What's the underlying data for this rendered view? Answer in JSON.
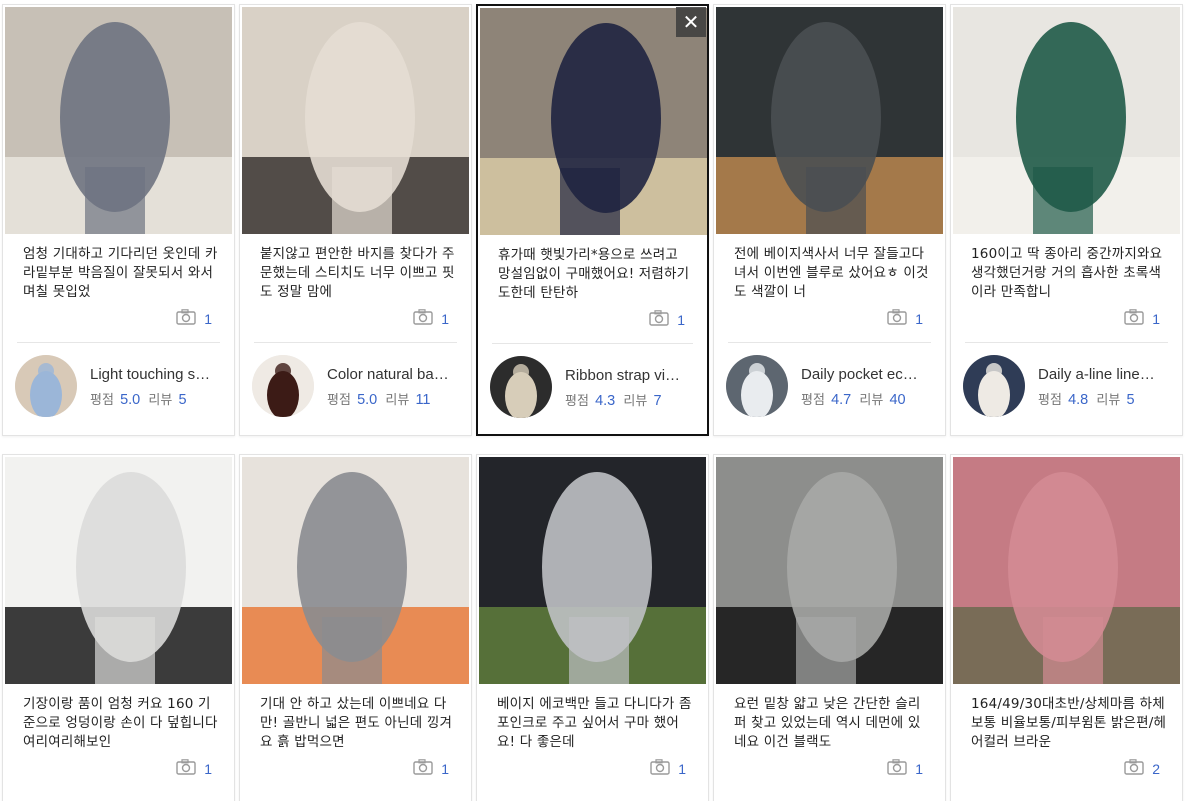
{
  "cards": [
    {
      "review": "엄청 기대하고 기다리던 옷인데 카라밑부분 박음질이 잘못되서 와서 며칠 못입었",
      "photo_count": "1",
      "product_name": "Light touching s…",
      "rating_label": "평점",
      "rating": "5.0",
      "review_label": "리뷰",
      "review_count": "5",
      "photo_colors": [
        "#c7c0b6",
        "#6e7381",
        "#e9e5de"
      ],
      "avatar_colors": [
        "#9bb6d8",
        "#d8c9b7"
      ]
    },
    {
      "review": "붙지않고 편안한 바지를 찾다가 주문했는데 스티치도 너무 이쁘고 핏도 정말 맘에",
      "photo_count": "1",
      "product_name": "Color natural ba…",
      "rating_label": "평점",
      "rating": "5.0",
      "review_label": "리뷰",
      "review_count": "11",
      "photo_colors": [
        "#d9d1c6",
        "#e4ddd3",
        "#3a3531"
      ],
      "avatar_colors": [
        "#3c1b16",
        "#efeae4"
      ]
    },
    {
      "review": "휴가때 햇빛가리*용으로 쓰려고 망설임없이 구매했어요! 저렴하기도한데 탄탄하",
      "photo_count": "1",
      "product_name": "Ribbon strap vi…",
      "rating_label": "평점",
      "rating": "4.3",
      "review_label": "리뷰",
      "review_count": "7",
      "photo_colors": [
        "#8e8478",
        "#1f2340",
        "#d8c9a5"
      ],
      "avatar_colors": [
        "#d7cdb9",
        "#2c2c2c"
      ],
      "selected": true,
      "close_glyph": "✕"
    },
    {
      "review": "전에 베이지색사서 너무 잘들고다녀서 이번엔 블루로 샀어요ㅎ 이것도 색깔이 너",
      "photo_count": "1",
      "product_name": "Daily pocket ec…",
      "rating_label": "평점",
      "rating": "4.7",
      "review_label": "리뷰",
      "review_count": "40",
      "photo_colors": [
        "#2f3436",
        "#4a4f52",
        "#b8864e"
      ],
      "avatar_colors": [
        "#e9ecef",
        "#5d6670"
      ]
    },
    {
      "review": "160이고 딱 종아리 중간까지와요 생각했던거랑 거의 흡사한 초록색이라 만족합니",
      "photo_count": "1",
      "product_name": "Daily a-line line…",
      "rating_label": "평점",
      "rating": "4.8",
      "review_label": "리뷰",
      "review_count": "5",
      "photo_colors": [
        "#e8e6e1",
        "#1f5a48",
        "#f3f1ec"
      ],
      "avatar_colors": [
        "#eeeae4",
        "#2f3c56"
      ]
    },
    {
      "review": "기장이랑 품이 엄청 커요 160 기준으로 엉덩이랑 손이 다 덮힙니다 여리여리해보인",
      "photo_count": "1",
      "photo_colors": [
        "#f2f2f0",
        "#dcdcda",
        "#1b1b1b"
      ]
    },
    {
      "review": "기대 안 하고 샀는데 이쁘네요 다만! 골반니 넓은 편도 아닌데 낑겨요 흙 밥먹으면",
      "photo_count": "1",
      "photo_colors": [
        "#e7e2dc",
        "#8a8c90",
        "#e87b3c"
      ]
    },
    {
      "review": "베이지 에코백만 들고 다니다가 좀 포인크로 주고 싶어서 구마 했어요! 다 좋은데",
      "photo_count": "1",
      "photo_colors": [
        "#23252a",
        "#bfc1c4",
        "#5f7e3c"
      ]
    },
    {
      "review": "요런 밑창 얇고 낮은 간단한 슬리퍼 찾고 있었는데 역시 데먼에 있네요 이건 블랙도",
      "photo_count": "1",
      "photo_colors": [
        "#8d8e8c",
        "#a7a8a6",
        "#141414"
      ]
    },
    {
      "review": "164/49/30대초반/상체마름 하체보통 비율보통/피부윔톤 밝은편/헤어컬러 브라운",
      "photo_count": "2",
      "photo_colors": [
        "#c57b84",
        "#d38b93",
        "#6b6a4f"
      ]
    }
  ]
}
